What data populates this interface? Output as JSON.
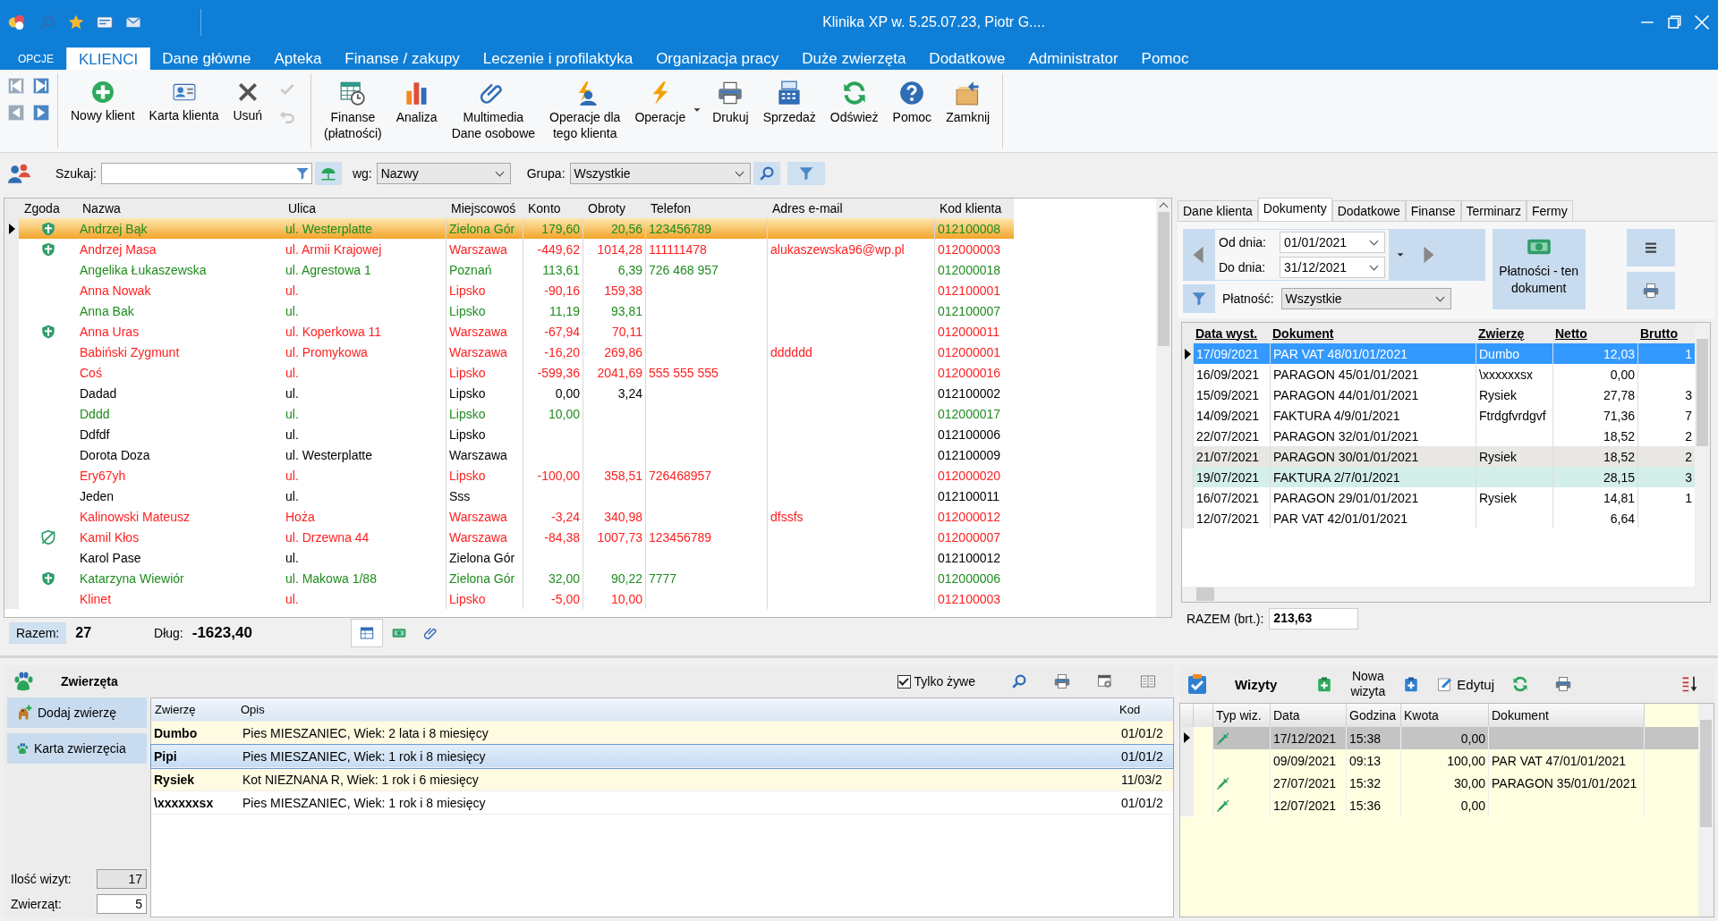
{
  "window": {
    "title": "Klinika XP w. 5.25.07.23, Piotr G...."
  },
  "menu": [
    {
      "label": "OPCJE",
      "selected": false,
      "kind": "file"
    },
    {
      "label": "KLIENCI",
      "selected": true
    },
    {
      "label": "Dane główne",
      "selected": false
    },
    {
      "label": "Apteka",
      "selected": false
    },
    {
      "label": "Finanse / zakupy",
      "selected": false
    },
    {
      "label": "Leczenie i profilaktyka",
      "selected": false
    },
    {
      "label": "Organizacja pracy",
      "selected": false
    },
    {
      "label": "Duże zwierzęta",
      "selected": false
    },
    {
      "label": "Dodatkowe",
      "selected": false
    },
    {
      "label": "Administrator",
      "selected": false
    },
    {
      "label": "Pomoc",
      "selected": false
    }
  ],
  "ribbon": {
    "group_1": [
      {
        "label": "Nowy klient"
      },
      {
        "label": "Karta klienta"
      },
      {
        "label": "Usuń"
      }
    ],
    "small_actions": [
      {
        "disabled": true
      },
      {
        "disabled": true
      }
    ],
    "group_2": [
      {
        "label": "Finanse\n(płatności)",
        "dropdown": false
      },
      {
        "label": "Analiza",
        "dropdown": false
      },
      {
        "label": "Multimedia\nDane osobowe",
        "dropdown": false
      },
      {
        "label": "Operacje dla\ntego klienta",
        "dropdown": false
      },
      {
        "label": "Operacje",
        "dropdown": true
      },
      {
        "label": "Drukuj",
        "dropdown": false
      },
      {
        "label": "Sprzedaż",
        "dropdown": false
      },
      {
        "label": "Odśwież",
        "dropdown": false
      },
      {
        "label": "Pomoc",
        "dropdown": false
      },
      {
        "label": "Zamknij",
        "dropdown": false
      }
    ]
  },
  "search": {
    "label": "Szukaj:",
    "by_label": "wg:",
    "by_value": "Nazwy",
    "group_label": "Grupa:",
    "group_value": "Wszystkie"
  },
  "clients": {
    "columns": [
      "Zgoda",
      "Nazwa",
      "Ulica",
      "Miejscowoś",
      "Konto",
      "Obroty",
      "Telefon",
      "Adres e-mail",
      "Kod klienta"
    ],
    "rows": [
      {
        "kind": "consent",
        "name": "Andrzej Bąk",
        "street": "ul. Westerplatte",
        "city": "Zielona Gór",
        "balance": "179,60",
        "turnover": "20,56",
        "phone": "123456789",
        "code": "012100008",
        "color": "#1e8c1e",
        "selected": true
      },
      {
        "kind": "consent",
        "name": "Andrzej Masa",
        "street": "ul. Armii Krajowej",
        "city": "Warszawa",
        "balance": "-449,62",
        "turnover": "1014,28",
        "phone": "111111478",
        "email": "alukaszewska96@wp.pl",
        "code": "012000003",
        "color": "#ff2020",
        "selected": false
      },
      {
        "kind": "plain",
        "name": "Angelika Łukaszewska",
        "street": "ul. Agrestowa 1",
        "city": "Poznań",
        "balance": "113,61",
        "turnover": "6,39",
        "phone": "726 468 957",
        "code": "012000018",
        "color": "#1e8c1e",
        "selected": false
      },
      {
        "kind": "plain",
        "name": "Anna Nowak",
        "street": "ul.",
        "city": "Lipsko",
        "balance": "-90,16",
        "turnover": "159,38",
        "code": "012100001",
        "color": "#ff2020",
        "selected": false
      },
      {
        "kind": "plain",
        "name": "Anna Bak",
        "street": "ul.",
        "city": "Lipsko",
        "balance": "11,19",
        "turnover": "93,81",
        "code": "012100007",
        "color": "#1e8c1e",
        "selected": false
      },
      {
        "kind": "consent",
        "name": "Anna Uras",
        "street": "ul. Koperkowa 11",
        "city": "Warszawa",
        "balance": "-67,94",
        "turnover": "70,11",
        "code": "012000011",
        "color": "#ff2020",
        "selected": false
      },
      {
        "kind": "plain",
        "name": "Babiński Zygmunt",
        "street": "ul. Promykowa",
        "city": "Warszawa",
        "balance": "-16,20",
        "turnover": "269,86",
        "email": "dddddd",
        "code": "012000001",
        "color": "#ff2020",
        "selected": false
      },
      {
        "kind": "plain",
        "name": "Coś",
        "street": "ul.",
        "city": "Lipsko",
        "balance": "-599,36",
        "turnover": "2041,69",
        "phone": "555 555 555",
        "code": "012000016",
        "color": "#ff2020",
        "selected": false
      },
      {
        "kind": "plain",
        "name": "Dadad",
        "street": "ul.",
        "city": "Lipsko",
        "balance": "0,00",
        "turnover": "3,24",
        "code": "012100002",
        "color": "#000000",
        "selected": false
      },
      {
        "kind": "plain",
        "name": "Dddd",
        "street": "ul.",
        "city": "Lipsko",
        "balance": "10,00",
        "code": "012000017",
        "color": "#1e8c1e",
        "selected": false
      },
      {
        "kind": "plain",
        "name": "Ddfdf",
        "street": "ul.",
        "city": "Lipsko",
        "code": "012100006",
        "color": "#000000",
        "selected": false
      },
      {
        "kind": "plain",
        "name": "Dorota Doza",
        "street": "ul. Westerplatte",
        "city": "Warszawa",
        "code": "012100009",
        "color": "#000000",
        "selected": false
      },
      {
        "kind": "plain",
        "name": "Ery67yh",
        "street": "ul.",
        "city": "Lipsko",
        "balance": "-100,00",
        "turnover": "358,51",
        "phone": "726468957",
        "code": "012000020",
        "color": "#ff2020",
        "selected": false
      },
      {
        "kind": "plain",
        "name": "Jeden",
        "street": "ul.",
        "city": "Sss",
        "code": "012100011",
        "color": "#000000",
        "selected": false
      },
      {
        "kind": "plain",
        "name": "Kalinowski Mateusz",
        "street": "Hoża",
        "city": "Warszawa",
        "balance": "-3,24",
        "turnover": "340,98",
        "email": "dfssfs",
        "code": "012000012",
        "color": "#ff2020",
        "selected": false
      },
      {
        "kind": "withdrawn",
        "name": "Kamil Kłos",
        "street": "ul. Drzewna 44",
        "city": "Warszawa",
        "balance": "-84,38",
        "turnover": "1007,73",
        "phone": "123456789",
        "code": "012000007",
        "color": "#ff2020",
        "selected": false
      },
      {
        "kind": "plain",
        "name": "Karol Pase",
        "street": "ul.",
        "city": "Zielona Gór",
        "code": "012100012",
        "color": "#000000",
        "selected": false
      },
      {
        "kind": "consent",
        "name": "Katarzyna Wiewiór",
        "street": "ul. Makowa 1/88",
        "city": "Zielona Gór",
        "balance": "32,00",
        "turnover": "90,22",
        "phone": "7777",
        "code": "012000006",
        "color": "#1e8c1e",
        "selected": false
      },
      {
        "kind": "plain",
        "name": "Klinet",
        "street": "ul.",
        "city": "Lipsko",
        "balance": "-5,00",
        "turnover": "10,00",
        "code": "012100003",
        "color": "#ff2020",
        "selected": false
      }
    ]
  },
  "status": {
    "total_label": "Razem:",
    "total": "27",
    "debt_label": "Dług:",
    "debt": "-1623,40",
    "view_tabs": [
      {
        "selected": true
      },
      {
        "selected": false
      },
      {
        "selected": false
      }
    ]
  },
  "side_tabs": [
    {
      "label": "Dane klienta",
      "selected": false
    },
    {
      "label": "Dokumenty",
      "selected": true
    },
    {
      "label": "Dodatkowe",
      "selected": false
    },
    {
      "label": "Finanse",
      "selected": false
    },
    {
      "label": "Terminarz",
      "selected": false
    },
    {
      "label": "Fermy",
      "selected": false
    }
  ],
  "documents": {
    "from_label": "Od dnia:",
    "from": "01/01/2021",
    "to_label": "Do dnia:",
    "to": "31/12/2021",
    "payment_label": "Płatność:",
    "payment": "Wszystkie",
    "payments_button": "Płatności - ten dokument",
    "columns": [
      "Data wyst.",
      "Dokument",
      "Zwierzę",
      "Netto",
      "Brutto"
    ],
    "rows": [
      {
        "date": "17/09/2021",
        "document": "PAR VAT 48/01/01/2021",
        "animal": "Dumbo",
        "net": "12,03",
        "gross": "1",
        "selected": true
      },
      {
        "date": "16/09/2021",
        "document": "PARAGON 45/01/01/2021",
        "animal": "\\xxxxxxsx",
        "net": "0,00",
        "selected": false
      },
      {
        "date": "15/09/2021",
        "document": "PARAGON 44/01/01/2021",
        "animal": "Rysiek",
        "net": "27,78",
        "gross": "3",
        "selected": false
      },
      {
        "date": "14/09/2021",
        "document": "FAKTURA 4/9/01/2021",
        "animal": "Ftrdgfvrdgvf",
        "net": "71,36",
        "gross": "7",
        "selected": false
      },
      {
        "date": "22/07/2021",
        "document": "PARAGON 32/01/01/2021",
        "net": "18,52",
        "gross": "2",
        "selected": false
      },
      {
        "date": "21/07/2021",
        "document": "PARAGON 30/01/01/2021",
        "animal": "Rysiek",
        "net": "18,52",
        "gross": "2",
        "color": "#e9e7e3",
        "selected": false
      },
      {
        "date": "19/07/2021",
        "document": "FAKTURA 2/7/01/2021",
        "net": "28,15",
        "gross": "3",
        "color": "#d4eee9",
        "selected": false
      },
      {
        "date": "16/07/2021",
        "document": "PARAGON 29/01/01/2021",
        "animal": "Rysiek",
        "net": "14,81",
        "gross": "1",
        "selected": false
      },
      {
        "date": "12/07/2021",
        "document": "PAR VAT 42/01/01/2021",
        "net": "6,64",
        "selected": false
      }
    ],
    "total_label": "RAZEM (brt.):",
    "total": "213,63"
  },
  "animals": {
    "title": "Zwierzęta",
    "alive_only": {
      "label": "Tylko żywe",
      "checked": true
    },
    "add_button": "Dodaj zwierzę",
    "card_button": "Karta zwierzęcia",
    "visits_label": "Ilość wizyt:",
    "visits": "17",
    "count_label": "Zwierząt:",
    "count": "5",
    "columns": [
      "Zwierzę",
      "Opis",
      "Kod"
    ],
    "rows": [
      {
        "name": "Dumbo",
        "description": "Pies MIESZANIEC, Wiek: 2 lata i 8 miesięcy",
        "code": "01/01/2",
        "color": "#fffbe2",
        "selected": false
      },
      {
        "name": "Pipi",
        "description": "Pies MIESZANIEC, Wiek: 1 rok i 8 miesięcy",
        "code": "01/01/2",
        "selected": true
      },
      {
        "name": "Rysiek",
        "description": "Kot NIEZNANA R, Wiek: 1 rok i 6 miesięcy",
        "code": "11/03/2",
        "color": "#fffbe2",
        "selected": false
      },
      {
        "name": "\\xxxxxxsx",
        "description": "Pies MIESZANIEC, Wiek: 1 rok i 8 miesięcy",
        "code": "01/01/2",
        "color": "#ffffff",
        "selected": false
      }
    ]
  },
  "visits": {
    "title": "Wizyty",
    "new_button": "Nowa\nwizyta",
    "edit_button": "Edytuj",
    "columns": [
      "Typ wiz.",
      "Data",
      "Godzina",
      "Kwota",
      "Dokument"
    ],
    "rows": [
      {
        "syringe": true,
        "date": "17/12/2021",
        "time": "15:38",
        "amount": "0,00",
        "selected": true
      },
      {
        "syringe": false,
        "date": "09/09/2021",
        "time": "09:13",
        "amount": "100,00",
        "document": "PAR VAT 47/01/01/2021",
        "selected": false
      },
      {
        "syringe": true,
        "date": "27/07/2021",
        "time": "15:32",
        "amount": "30,00",
        "document": "PARAGON 35/01/01/2021",
        "selected": false
      },
      {
        "syringe": true,
        "date": "12/07/2021",
        "time": "15:36",
        "amount": "0,00",
        "selected": false
      }
    ]
  }
}
